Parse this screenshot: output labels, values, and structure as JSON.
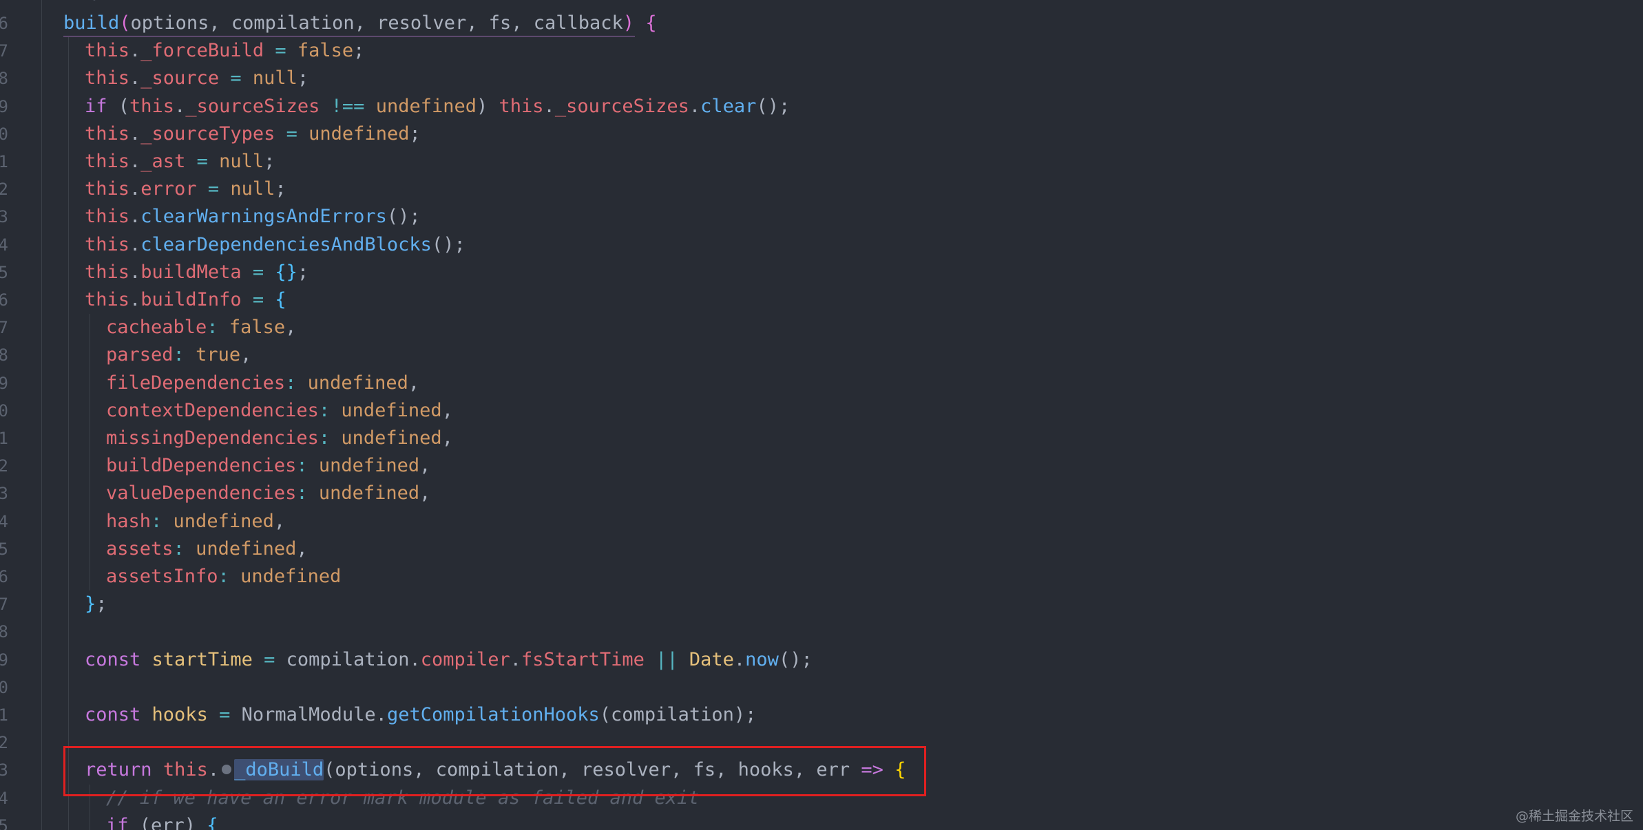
{
  "gutter": {
    "line_numbers": [
      "6",
      "7",
      "8",
      "9",
      "0",
      "1",
      "2",
      "3",
      "4",
      "5",
      "6",
      "7",
      "8",
      "9",
      "0",
      "1",
      "2",
      "3",
      "4",
      "5",
      "6",
      "7",
      "8",
      "9",
      "0",
      "1",
      "2",
      "3",
      "4",
      "5"
    ]
  },
  "top_partial": "*/",
  "code_lines": [
    {
      "indent": 0,
      "tokens": [
        [
          "fn",
          "build"
        ],
        [
          "brace-p",
          "("
        ],
        [
          "plain",
          "options, compilation, resolver, fs, callback"
        ],
        [
          "brace-p",
          ")"
        ],
        [
          "plain",
          " "
        ],
        [
          "brace-p",
          "{"
        ]
      ]
    },
    {
      "indent": 1,
      "tokens": [
        [
          "this",
          "this"
        ],
        [
          "plain",
          "."
        ],
        [
          "prop",
          "_forceBuild"
        ],
        [
          "op",
          " = "
        ],
        [
          "const",
          "false"
        ],
        [
          "plain",
          ";"
        ]
      ]
    },
    {
      "indent": 1,
      "tokens": [
        [
          "this",
          "this"
        ],
        [
          "plain",
          "."
        ],
        [
          "prop",
          "_source"
        ],
        [
          "op",
          " = "
        ],
        [
          "const",
          "null"
        ],
        [
          "plain",
          ";"
        ]
      ]
    },
    {
      "indent": 1,
      "tokens": [
        [
          "kw",
          "if"
        ],
        [
          "plain",
          " ("
        ],
        [
          "this",
          "this"
        ],
        [
          "plain",
          "."
        ],
        [
          "prop",
          "_sourceSizes"
        ],
        [
          "op",
          " !== "
        ],
        [
          "const",
          "undefined"
        ],
        [
          "plain",
          ") "
        ],
        [
          "this",
          "this"
        ],
        [
          "plain",
          "."
        ],
        [
          "prop",
          "_sourceSizes"
        ],
        [
          "plain",
          "."
        ],
        [
          "fn",
          "clear"
        ],
        [
          "plain",
          "();"
        ]
      ]
    },
    {
      "indent": 1,
      "tokens": [
        [
          "this",
          "this"
        ],
        [
          "plain",
          "."
        ],
        [
          "prop",
          "_sourceTypes"
        ],
        [
          "op",
          " = "
        ],
        [
          "const",
          "undefined"
        ],
        [
          "plain",
          ";"
        ]
      ]
    },
    {
      "indent": 1,
      "tokens": [
        [
          "this",
          "this"
        ],
        [
          "plain",
          "."
        ],
        [
          "prop",
          "_ast"
        ],
        [
          "op",
          " = "
        ],
        [
          "const",
          "null"
        ],
        [
          "plain",
          ";"
        ]
      ]
    },
    {
      "indent": 1,
      "tokens": [
        [
          "this",
          "this"
        ],
        [
          "plain",
          "."
        ],
        [
          "prop",
          "error"
        ],
        [
          "op",
          " = "
        ],
        [
          "const",
          "null"
        ],
        [
          "plain",
          ";"
        ]
      ]
    },
    {
      "indent": 1,
      "tokens": [
        [
          "this",
          "this"
        ],
        [
          "plain",
          "."
        ],
        [
          "fn",
          "clearWarningsAndErrors"
        ],
        [
          "plain",
          "();"
        ]
      ]
    },
    {
      "indent": 1,
      "tokens": [
        [
          "this",
          "this"
        ],
        [
          "plain",
          "."
        ],
        [
          "fn",
          "clearDependenciesAndBlocks"
        ],
        [
          "plain",
          "();"
        ]
      ]
    },
    {
      "indent": 1,
      "tokens": [
        [
          "this",
          "this"
        ],
        [
          "plain",
          "."
        ],
        [
          "prop",
          "buildMeta"
        ],
        [
          "op",
          " = "
        ],
        [
          "brace-b",
          "{}"
        ],
        [
          "plain",
          ";"
        ]
      ]
    },
    {
      "indent": 1,
      "tokens": [
        [
          "this",
          "this"
        ],
        [
          "plain",
          "."
        ],
        [
          "prop",
          "buildInfo"
        ],
        [
          "op",
          " = "
        ],
        [
          "brace-b",
          "{"
        ]
      ]
    },
    {
      "indent": 2,
      "tokens": [
        [
          "prop",
          "cacheable"
        ],
        [
          "op",
          ": "
        ],
        [
          "const",
          "false"
        ],
        [
          "plain",
          ","
        ]
      ]
    },
    {
      "indent": 2,
      "tokens": [
        [
          "prop",
          "parsed"
        ],
        [
          "op",
          ": "
        ],
        [
          "const",
          "true"
        ],
        [
          "plain",
          ","
        ]
      ]
    },
    {
      "indent": 2,
      "tokens": [
        [
          "prop",
          "fileDependencies"
        ],
        [
          "op",
          ": "
        ],
        [
          "const",
          "undefined"
        ],
        [
          "plain",
          ","
        ]
      ]
    },
    {
      "indent": 2,
      "tokens": [
        [
          "prop",
          "contextDependencies"
        ],
        [
          "op",
          ": "
        ],
        [
          "const",
          "undefined"
        ],
        [
          "plain",
          ","
        ]
      ]
    },
    {
      "indent": 2,
      "tokens": [
        [
          "prop",
          "missingDependencies"
        ],
        [
          "op",
          ": "
        ],
        [
          "const",
          "undefined"
        ],
        [
          "plain",
          ","
        ]
      ]
    },
    {
      "indent": 2,
      "tokens": [
        [
          "prop",
          "buildDependencies"
        ],
        [
          "op",
          ": "
        ],
        [
          "const",
          "undefined"
        ],
        [
          "plain",
          ","
        ]
      ]
    },
    {
      "indent": 2,
      "tokens": [
        [
          "prop",
          "valueDependencies"
        ],
        [
          "op",
          ": "
        ],
        [
          "const",
          "undefined"
        ],
        [
          "plain",
          ","
        ]
      ]
    },
    {
      "indent": 2,
      "tokens": [
        [
          "prop",
          "hash"
        ],
        [
          "op",
          ": "
        ],
        [
          "const",
          "undefined"
        ],
        [
          "plain",
          ","
        ]
      ]
    },
    {
      "indent": 2,
      "tokens": [
        [
          "prop",
          "assets"
        ],
        [
          "op",
          ": "
        ],
        [
          "const",
          "undefined"
        ],
        [
          "plain",
          ","
        ]
      ]
    },
    {
      "indent": 2,
      "tokens": [
        [
          "prop",
          "assetsInfo"
        ],
        [
          "op",
          ": "
        ],
        [
          "const",
          "undefined"
        ]
      ]
    },
    {
      "indent": 1,
      "tokens": [
        [
          "brace-b",
          "}"
        ],
        [
          "plain",
          ";"
        ]
      ]
    },
    {
      "indent": 1,
      "tokens": []
    },
    {
      "indent": 1,
      "tokens": [
        [
          "kw",
          "const"
        ],
        [
          "plain",
          " "
        ],
        [
          "var",
          "startTime"
        ],
        [
          "op",
          " = "
        ],
        [
          "plain",
          "compilation."
        ],
        [
          "prop",
          "compiler"
        ],
        [
          "plain",
          "."
        ],
        [
          "prop",
          "fsStartTime"
        ],
        [
          "op",
          " || "
        ],
        [
          "class",
          "Date"
        ],
        [
          "plain",
          "."
        ],
        [
          "fn",
          "now"
        ],
        [
          "plain",
          "();"
        ]
      ]
    },
    {
      "indent": 1,
      "tokens": []
    },
    {
      "indent": 1,
      "tokens": [
        [
          "kw",
          "const"
        ],
        [
          "plain",
          " "
        ],
        [
          "var",
          "hooks"
        ],
        [
          "op",
          " = "
        ],
        [
          "plain",
          "NormalModule."
        ],
        [
          "fn",
          "getCompilationHooks"
        ],
        [
          "plain",
          "(compilation);"
        ]
      ]
    },
    {
      "indent": 1,
      "tokens": []
    },
    {
      "indent": 1,
      "tokens": [
        [
          "kw",
          "return"
        ],
        [
          "plain",
          " "
        ],
        [
          "this",
          "this"
        ],
        [
          "plain",
          "."
        ],
        [
          "dot",
          ""
        ],
        [
          "sel",
          "_doBuild"
        ],
        [
          "plain",
          "(options, compilation, resolver, fs, hooks, err "
        ],
        [
          "kw",
          "=>"
        ],
        [
          "plain",
          " "
        ],
        [
          "brace-y",
          "{"
        ]
      ]
    },
    {
      "indent": 2,
      "tokens": [
        [
          "comment",
          "// if we have an error mark module as failed and exit"
        ]
      ]
    },
    {
      "indent": 2,
      "tokens": [
        [
          "kw",
          "if"
        ],
        [
          "plain",
          " (err) "
        ],
        [
          "brace-b",
          "{"
        ]
      ]
    }
  ],
  "watermark": "@稀土掘金技术社区"
}
